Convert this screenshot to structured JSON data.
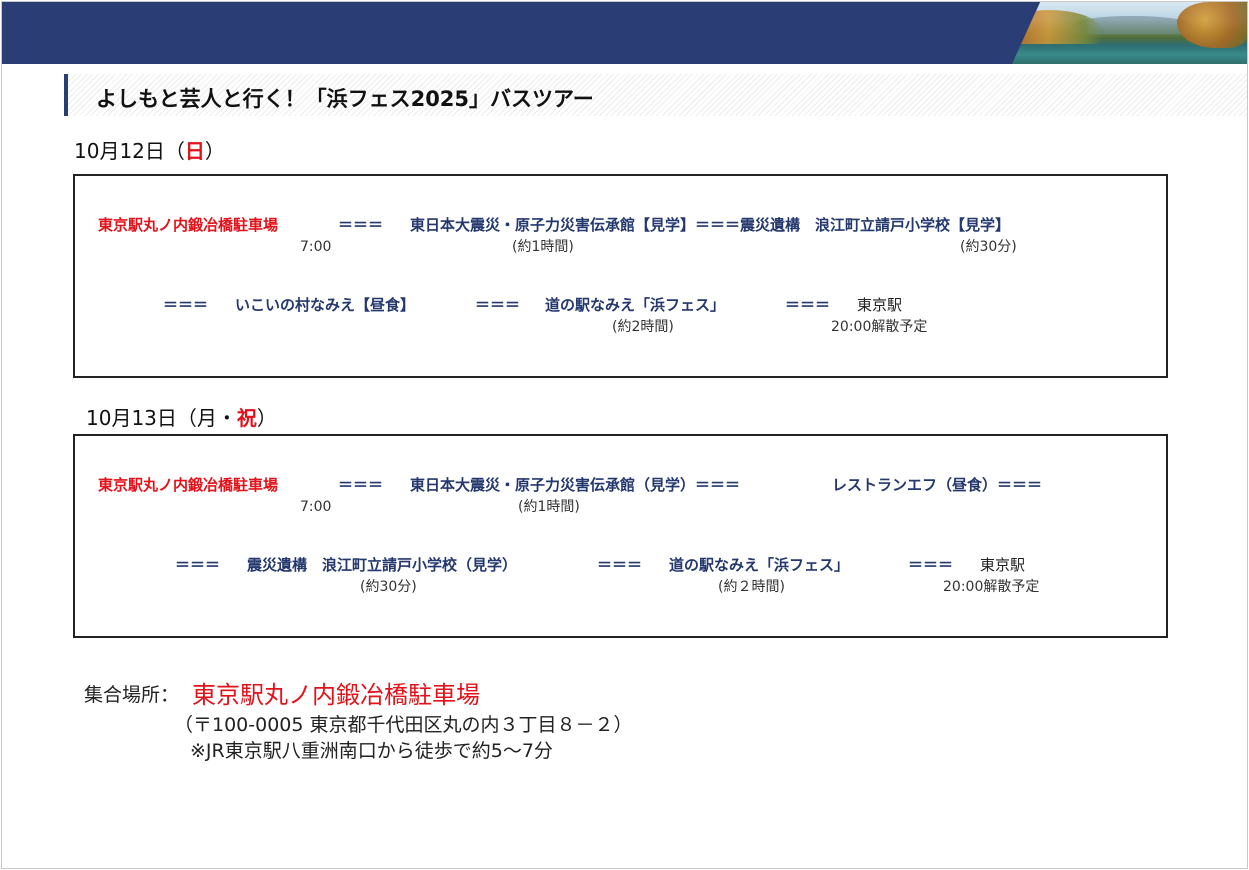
{
  "header": {
    "title": "よしもと芸人と行く！「浜フェス2025」バスツアー"
  },
  "day1": {
    "date_prefix": "10月12日（",
    "date_day": "日",
    "date_suffix": "）",
    "row1": {
      "place1": "東京駅丸ノ内鍛冶橋駐車場",
      "sep1": "＝＝＝",
      "place2": "東日本大震災・原子力災害伝承館【見学】＝＝＝震災遺構　浪江町立請戸小学校【見学】",
      "time1": "7:00",
      "dur2": "(約1時間)",
      "dur3": "(約30分)"
    },
    "row2": {
      "sep1": "＝＝＝",
      "place1": "いこいの村なみえ【昼食】",
      "sep2": "＝＝＝",
      "place2": "道の駅なみえ「浜フェス」",
      "sep3": "＝＝＝",
      "place3": "東京駅",
      "dur2": "(約2時間)",
      "time3": "20:00解散予定"
    }
  },
  "day2": {
    "date_prefix": "10月13日（月・",
    "date_day": "祝",
    "date_suffix": "）",
    "row1": {
      "place1": "東京駅丸ノ内鍛冶橋駐車場",
      "sep1": "＝＝＝",
      "place2": "東日本大震災・原子力災害伝承館（見学）＝＝＝",
      "place3": "レストランエフ（昼食）＝＝＝",
      "time1": "7:00",
      "dur2": "(約1時間)"
    },
    "row2": {
      "sep1": "＝＝＝",
      "place1": "震災遺構　浪江町立請戸小学校（見学）",
      "sep2": "＝＝＝",
      "place2": "道の駅なみえ「浜フェス」",
      "sep3": "＝＝＝",
      "place3": "東京駅",
      "dur1": "(約30分)",
      "dur2": "(約２時間)",
      "time3": "20:00解散予定"
    }
  },
  "meeting": {
    "label": "集合場所：",
    "place": "東京駅丸ノ内鍛冶橋駐車場",
    "address": "（〒100-0005 東京都千代田区丸の内３丁目８－２）",
    "access": "※JR東京駅八重洲南口から徒歩で約5～7分"
  }
}
